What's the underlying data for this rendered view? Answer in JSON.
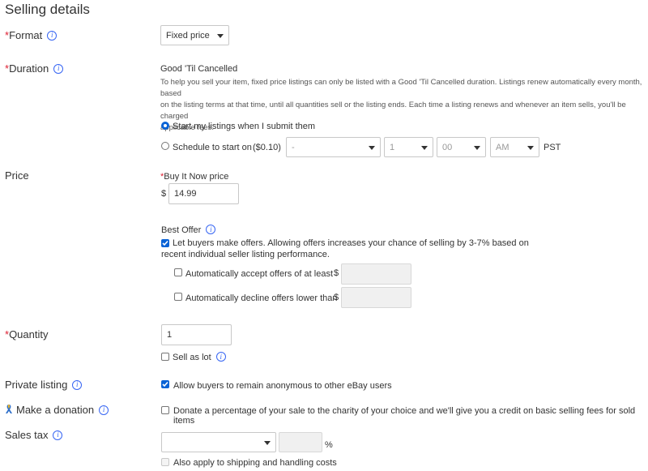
{
  "section_title": "Selling details",
  "required_marker": "*",
  "format": {
    "label": "Format",
    "value": "Fixed price"
  },
  "duration": {
    "label": "Duration",
    "value": "Good 'Til Cancelled",
    "description_lines": [
      "To help you sell your item, fixed price listings can only be listed with a Good 'Til Cancelled duration. Listings renew automatically every month, based",
      "on the listing terms at that time, until all quantities sell or the listing ends. Each time a listing renews and whenever an item sells, you'll be charged",
      "applicable fees."
    ],
    "start_now_label": "Start my listings when I submit them",
    "schedule_label": "Schedule to start on",
    "schedule_fee": "($0.10)",
    "schedule_date": "-",
    "schedule_hour": "1",
    "schedule_minute": "00",
    "schedule_ampm": "AM",
    "timezone": "PST"
  },
  "price": {
    "label": "Price",
    "buy_it_now_label": "Buy It Now price",
    "currency": "$",
    "value": "14.99"
  },
  "best_offer": {
    "label": "Best Offer",
    "allow_label_line1": "Let buyers make offers. Allowing offers increases your chance of selling by 3-7% based on",
    "allow_label_line2": "recent individual seller listing performance.",
    "auto_accept_label": "Automatically accept offers of at least",
    "auto_decline_label": "Automatically decline offers lower than",
    "currency": "$"
  },
  "quantity": {
    "label": "Quantity",
    "value": "1",
    "sell_as_lot_label": "Sell as lot"
  },
  "private_listing": {
    "label": "Private listing",
    "checkbox_label": "Allow buyers to remain anonymous to other eBay users"
  },
  "donation": {
    "label": "Make a donation",
    "checkbox_label": "Donate a percentage of your sale to the charity of your choice and we'll give you a credit on basic selling fees for sold items"
  },
  "sales_tax": {
    "label": "Sales tax",
    "state_value": "",
    "percent_value": "",
    "percent_symbol": "%",
    "shipping_label": "Also apply to shipping and handling costs"
  },
  "colors": {
    "required": "#dd1e31",
    "info": "#3665f3",
    "control_accent": "#0a63d6"
  },
  "icons": {
    "info": "info-icon",
    "dropdown": "chevron-down-icon",
    "donation": "ribbon-icon"
  }
}
